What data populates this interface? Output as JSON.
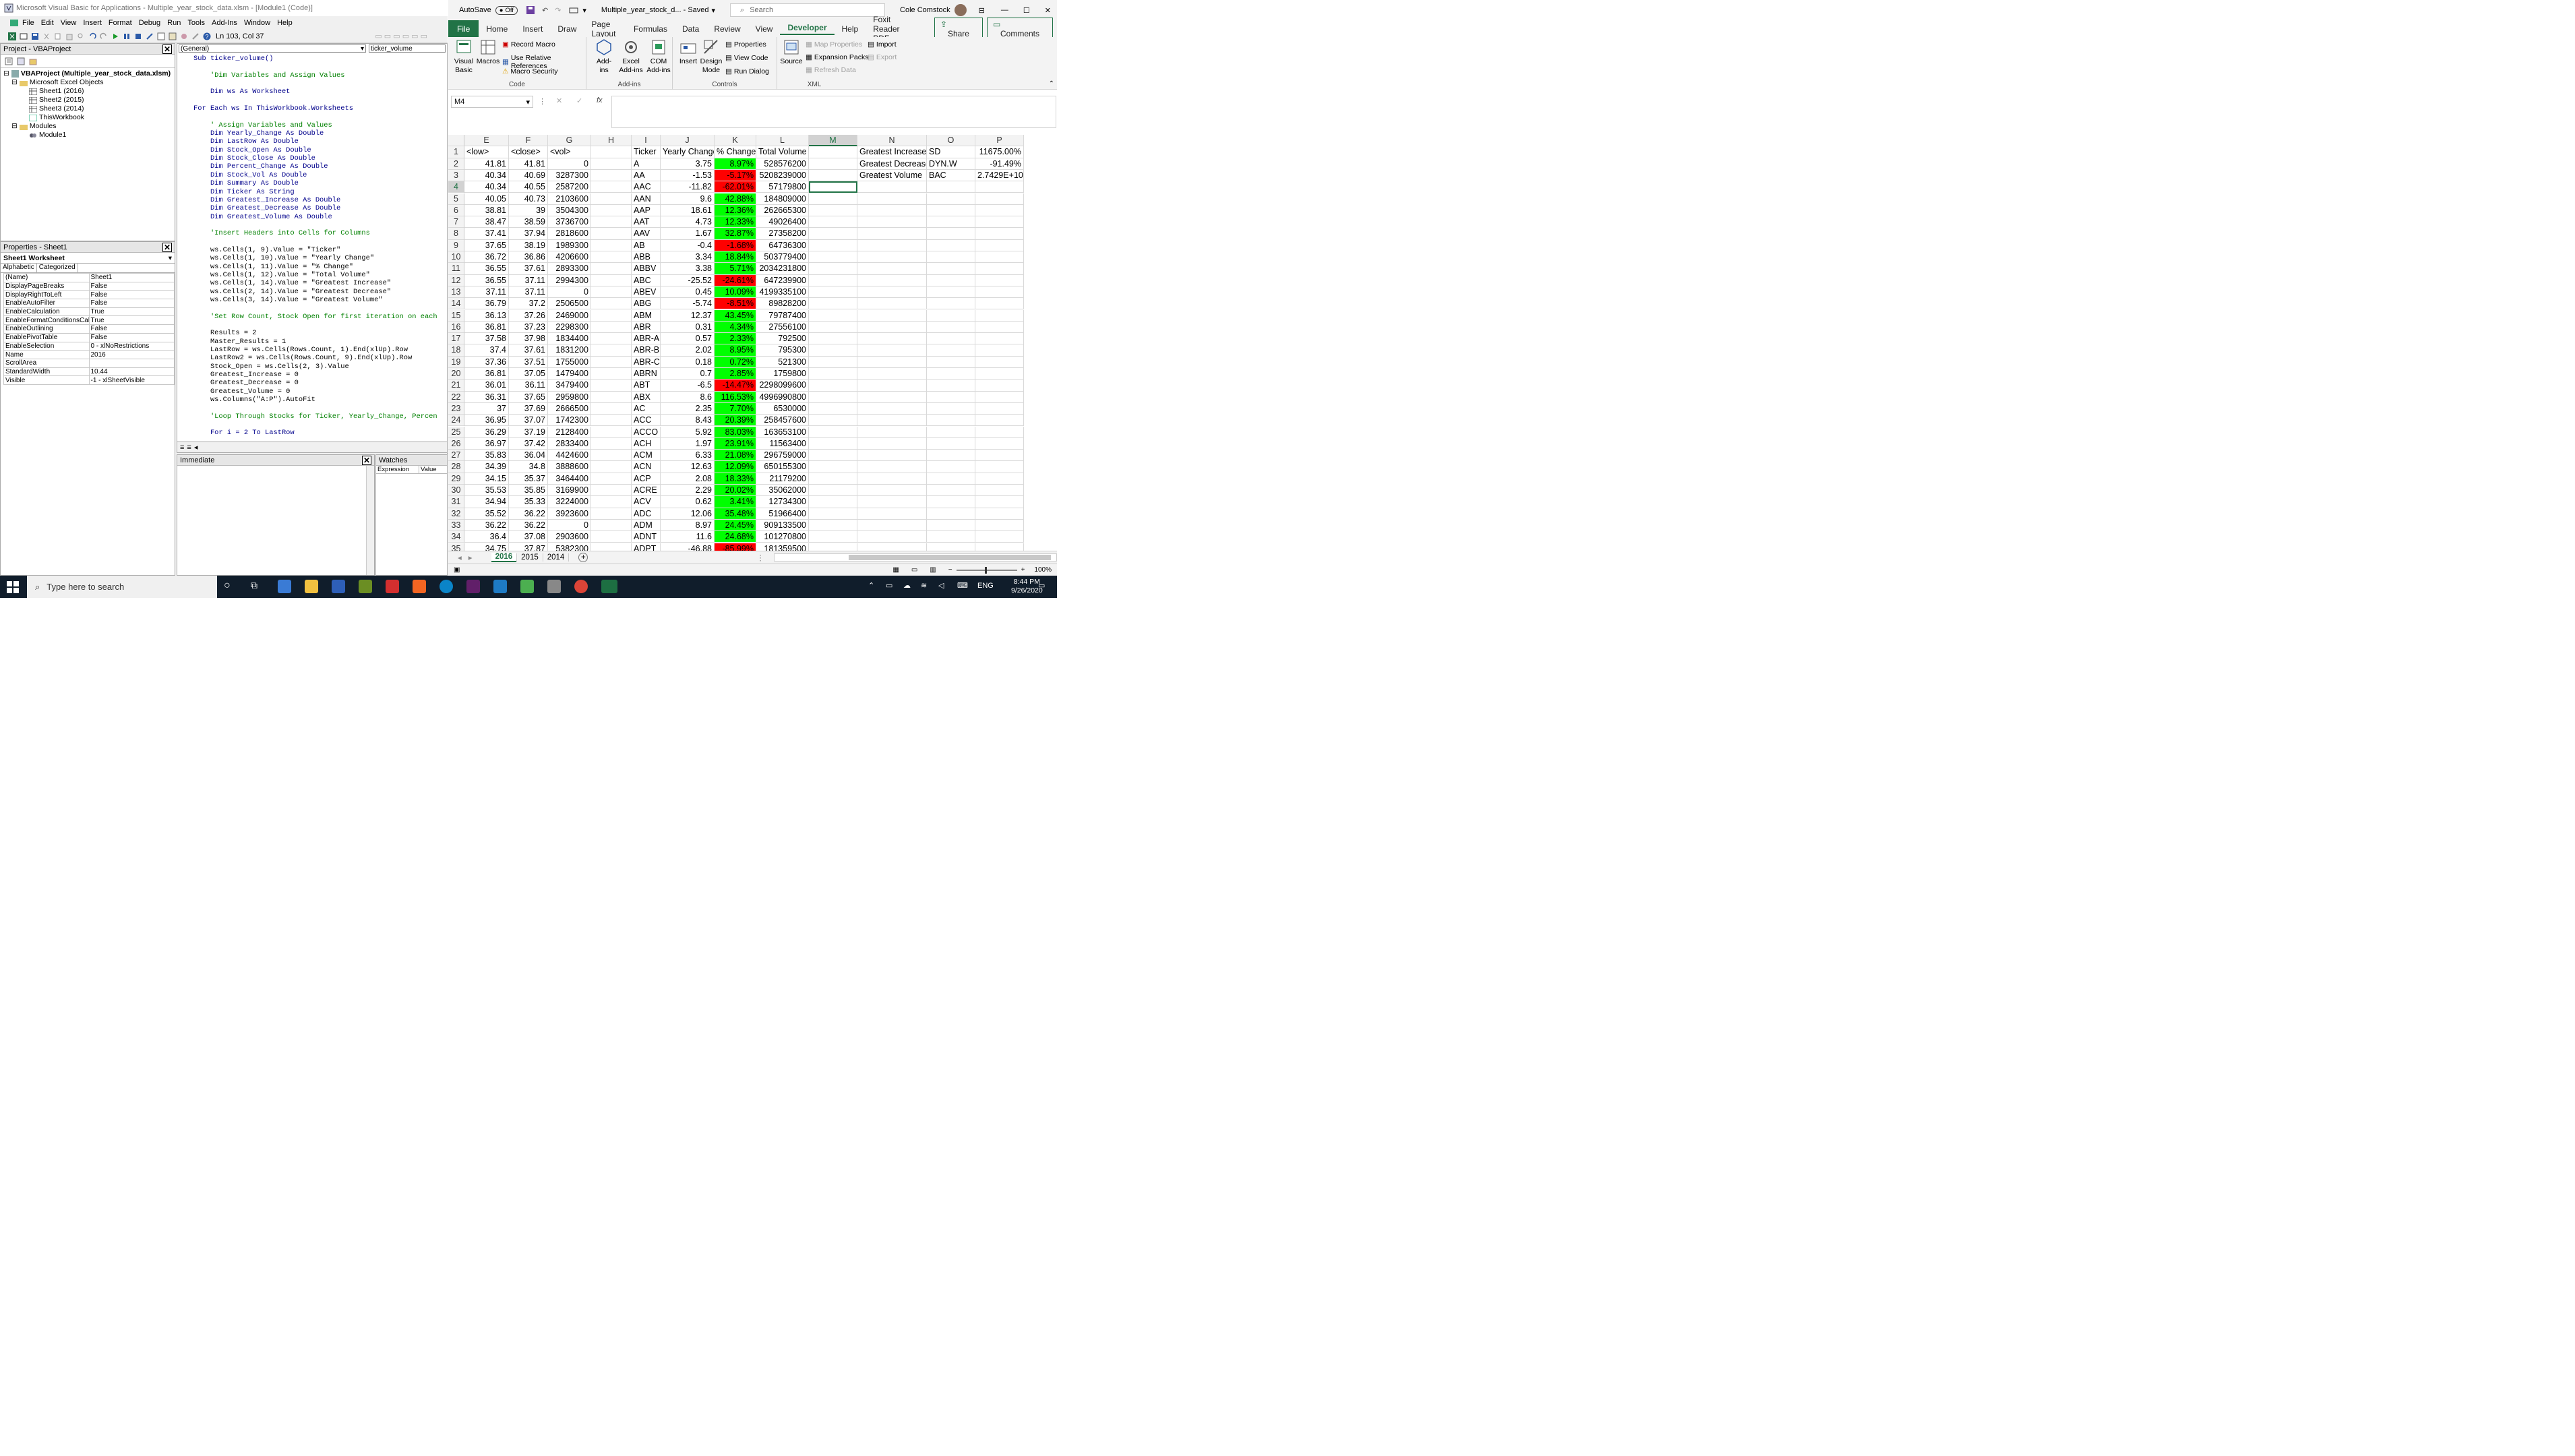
{
  "vbe": {
    "title": "Microsoft Visual Basic for Applications - Multiple_year_stock_data.xlsm - [Module1 (Code)]",
    "menu": [
      "File",
      "Edit",
      "View",
      "Insert",
      "Format",
      "Debug",
      "Run",
      "Tools",
      "Add-Ins",
      "Window",
      "Help"
    ],
    "position": "Ln 103, Col 37",
    "project": {
      "header": "Project - VBAProject",
      "root": "VBAProject (Multiple_year_stock_data.xlsm)",
      "folder_objects": "Microsoft Excel Objects",
      "sheets": [
        "Sheet1 (2016)",
        "Sheet2 (2015)",
        "Sheet3 (2014)",
        "ThisWorkbook"
      ],
      "folder_modules": "Modules",
      "module": "Module1"
    },
    "properties": {
      "header": "Properties - Sheet1",
      "selector": "Sheet1 Worksheet",
      "tabs": [
        "Alphabetic",
        "Categorized"
      ],
      "rows": [
        [
          "(Name)",
          "Sheet1"
        ],
        [
          "DisplayPageBreaks",
          "False"
        ],
        [
          "DisplayRightToLeft",
          "False"
        ],
        [
          "EnableAutoFilter",
          "False"
        ],
        [
          "EnableCalculation",
          "True"
        ],
        [
          "EnableFormatConditionsCalcul",
          "True"
        ],
        [
          "EnableOutlining",
          "False"
        ],
        [
          "EnablePivotTable",
          "False"
        ],
        [
          "EnableSelection",
          "0 - xlNoRestrictions"
        ],
        [
          "Name",
          "2016"
        ],
        [
          "ScrollArea",
          ""
        ],
        [
          "StandardWidth",
          "10.44"
        ],
        [
          "Visible",
          "-1 - xlSheetVisible"
        ]
      ]
    },
    "code": {
      "combo_left": "(General)",
      "combo_right": "ticker_volume",
      "lines": [
        {
          "t": "Sub ticker_volume()",
          "c": "kw"
        },
        {
          "t": "",
          "c": ""
        },
        {
          "t": "    'Dim Variables and Assign Values",
          "c": "cm"
        },
        {
          "t": "",
          "c": ""
        },
        {
          "t": "    Dim ws As Worksheet",
          "c": "kw"
        },
        {
          "t": "",
          "c": ""
        },
        {
          "t": "For Each ws In ThisWorkbook.Worksheets",
          "c": "kw"
        },
        {
          "t": "",
          "c": ""
        },
        {
          "t": "    ' Assign Variables and Values",
          "c": "cm"
        },
        {
          "t": "    Dim Yearly_Change As Double",
          "c": "kw"
        },
        {
          "t": "    Dim LastRow As Double",
          "c": "kw"
        },
        {
          "t": "    Dim Stock_Open As Double",
          "c": "kw"
        },
        {
          "t": "    Dim Stock_Close As Double",
          "c": "kw"
        },
        {
          "t": "    Dim Percent_Change As Double",
          "c": "kw"
        },
        {
          "t": "    Dim Stock_Vol As Double",
          "c": "kw"
        },
        {
          "t": "    Dim Summary As Double",
          "c": "kw"
        },
        {
          "t": "    Dim Ticker As String",
          "c": "kw"
        },
        {
          "t": "    Dim Greatest_Increase As Double",
          "c": "kw"
        },
        {
          "t": "    Dim Greatest_Decrease As Double",
          "c": "kw"
        },
        {
          "t": "    Dim Greatest_Volume As Double",
          "c": "kw"
        },
        {
          "t": "",
          "c": ""
        },
        {
          "t": "    'Insert Headers into Cells for Columns",
          "c": "cm"
        },
        {
          "t": "",
          "c": ""
        },
        {
          "t": "    ws.Cells(1, 9).Value = \"Ticker\"",
          "c": ""
        },
        {
          "t": "    ws.Cells(1, 10).Value = \"Yearly Change\"",
          "c": ""
        },
        {
          "t": "    ws.Cells(1, 11).Value = \"% Change\"",
          "c": ""
        },
        {
          "t": "    ws.Cells(1, 12).Value = \"Total Volume\"",
          "c": ""
        },
        {
          "t": "    ws.Cells(1, 14).Value = \"Greatest Increase\"",
          "c": ""
        },
        {
          "t": "    ws.Cells(2, 14).Value = \"Greatest Decrease\"",
          "c": ""
        },
        {
          "t": "    ws.Cells(3, 14).Value = \"Greatest Volume\"",
          "c": ""
        },
        {
          "t": "",
          "c": ""
        },
        {
          "t": "    'Set Row Count, Stock Open for first iteration on each",
          "c": "cm"
        },
        {
          "t": "",
          "c": ""
        },
        {
          "t": "    Results = 2",
          "c": ""
        },
        {
          "t": "    Master_Results = 1",
          "c": ""
        },
        {
          "t": "    LastRow = ws.Cells(Rows.Count, 1).End(xlUp).Row",
          "c": ""
        },
        {
          "t": "    LastRow2 = ws.Cells(Rows.Count, 9).End(xlUp).Row",
          "c": ""
        },
        {
          "t": "    Stock_Open = ws.Cells(2, 3).Value",
          "c": ""
        },
        {
          "t": "    Greatest_Increase = 0",
          "c": ""
        },
        {
          "t": "    Greatest_Decrease = 0",
          "c": ""
        },
        {
          "t": "    Greatest_Volume = 0",
          "c": ""
        },
        {
          "t": "    ws.Columns(\"A:P\").AutoFit",
          "c": ""
        },
        {
          "t": "",
          "c": ""
        },
        {
          "t": "    'Loop Through Stocks for Ticker, Yearly_Change, Percen",
          "c": "cm"
        },
        {
          "t": "",
          "c": ""
        },
        {
          "t": "    For i = 2 To LastRow",
          "c": "kw"
        }
      ]
    },
    "immediate": "Immediate",
    "watches": {
      "header": "Watches",
      "cols": [
        "Expression",
        "Value"
      ]
    }
  },
  "excel": {
    "autosave": "AutoSave",
    "autosave_state": "Off",
    "filename": "Multiple_year_stock_d...  -  Saved",
    "search_placeholder": "Search",
    "user": "Cole Comstock",
    "tabs": [
      "File",
      "Home",
      "Insert",
      "Draw",
      "Page Layout",
      "Formulas",
      "Data",
      "Review",
      "View",
      "Developer",
      "Help",
      "Foxit Reader PDF"
    ],
    "share": "Share",
    "comments": "Comments",
    "ribbon": {
      "visual_basic": "Visual Basic",
      "macros": "Macros",
      "record_macro": "Record Macro",
      "relative_refs": "Use Relative References",
      "macro_security": "Macro Security",
      "code_label": "Code",
      "addins": "Add-ins",
      "excel_addins": "Excel Add-ins",
      "com_addins": "COM Add-ins",
      "addins_label": "Add-ins",
      "insert": "Insert",
      "design_mode": "Design Mode",
      "properties": "Properties",
      "view_code": "View Code",
      "run_dialog": "Run Dialog",
      "controls_label": "Controls",
      "source": "Source",
      "map_properties": "Map Properties",
      "expansion_packs": "Expansion Packs",
      "refresh_data": "Refresh Data",
      "import": "Import",
      "export": "Export",
      "xml_label": "XML"
    },
    "namebox": "M4",
    "fx": "fx",
    "columns": [
      "E",
      "F",
      "G",
      "H",
      "I",
      "J",
      "K",
      "L",
      "M",
      "N",
      "O",
      "P"
    ],
    "header_row": [
      "<low>",
      "<close>",
      "<vol>",
      "",
      "Ticker",
      "Yearly Change",
      "% Change",
      "Total Volume",
      "",
      "Greatest Increase",
      "SD",
      "11675.00%"
    ],
    "summary": [
      [
        "Greatest Decrease",
        "DYN.W",
        "-91.49%"
      ],
      [
        "Greatest Volume",
        "BAC",
        "2.7429E+10"
      ]
    ],
    "rows": [
      [
        "41.81",
        "41.81",
        "0",
        "A",
        "3.75",
        "8.97%",
        "528576200"
      ],
      [
        "40.34",
        "40.69",
        "3287300",
        "AA",
        "-1.53",
        "-5.17%",
        "5208239000"
      ],
      [
        "40.34",
        "40.55",
        "2587200",
        "AAC",
        "-11.82",
        "-62.01%",
        "57179800"
      ],
      [
        "40.05",
        "40.73",
        "2103600",
        "AAN",
        "9.6",
        "42.88%",
        "184809000"
      ],
      [
        "38.81",
        "39",
        "3504300",
        "AAP",
        "18.61",
        "12.36%",
        "262665300"
      ],
      [
        "38.47",
        "38.59",
        "3736700",
        "AAT",
        "4.73",
        "12.33%",
        "49026400"
      ],
      [
        "37.41",
        "37.94",
        "2818600",
        "AAV",
        "1.67",
        "32.87%",
        "27358200"
      ],
      [
        "37.65",
        "38.19",
        "1989300",
        "AB",
        "-0.4",
        "-1.68%",
        "64736300"
      ],
      [
        "36.72",
        "36.86",
        "4206600",
        "ABB",
        "3.34",
        "18.84%",
        "503779400"
      ],
      [
        "36.55",
        "37.61",
        "2893300",
        "ABBV",
        "3.38",
        "5.71%",
        "2034231800"
      ],
      [
        "36.55",
        "37.11",
        "2994300",
        "ABC",
        "-25.52",
        "-24.61%",
        "647239900"
      ],
      [
        "37.11",
        "37.11",
        "0",
        "ABEV",
        "0.45",
        "10.09%",
        "4199335100"
      ],
      [
        "36.79",
        "37.2",
        "2506500",
        "ABG",
        "-5.74",
        "-8.51%",
        "89828200"
      ],
      [
        "36.13",
        "37.26",
        "2469000",
        "ABM",
        "12.37",
        "43.45%",
        "79787400"
      ],
      [
        "36.81",
        "37.23",
        "2298300",
        "ABR",
        "0.31",
        "4.34%",
        "27556100"
      ],
      [
        "37.58",
        "37.98",
        "1834400",
        "ABR-A",
        "0.57",
        "2.33%",
        "792500"
      ],
      [
        "37.4",
        "37.61",
        "1831200",
        "ABR-B",
        "2.02",
        "8.95%",
        "795300"
      ],
      [
        "37.36",
        "37.51",
        "1755000",
        "ABR-C",
        "0.18",
        "0.72%",
        "521300"
      ],
      [
        "36.81",
        "37.05",
        "1479400",
        "ABRN",
        "0.7",
        "2.85%",
        "1759800"
      ],
      [
        "36.01",
        "36.11",
        "3479400",
        "ABT",
        "-6.5",
        "-14.47%",
        "2298099600"
      ],
      [
        "36.31",
        "37.65",
        "2959800",
        "ABX",
        "8.6",
        "116.53%",
        "4996990800"
      ],
      [
        "37",
        "37.69",
        "2666500",
        "AC",
        "2.35",
        "7.70%",
        "6530000"
      ],
      [
        "36.95",
        "37.07",
        "1742300",
        "ACC",
        "8.43",
        "20.39%",
        "258457600"
      ],
      [
        "36.29",
        "37.19",
        "2128400",
        "ACCO",
        "5.92",
        "83.03%",
        "163653100"
      ],
      [
        "36.97",
        "37.42",
        "2833400",
        "ACH",
        "1.97",
        "23.91%",
        "11563400"
      ],
      [
        "35.83",
        "36.04",
        "4424600",
        "ACM",
        "6.33",
        "21.08%",
        "296759000"
      ],
      [
        "34.39",
        "34.8",
        "3888600",
        "ACN",
        "12.63",
        "12.09%",
        "650155300"
      ],
      [
        "34.15",
        "35.37",
        "3464400",
        "ACP",
        "2.08",
        "18.33%",
        "21179200"
      ],
      [
        "35.53",
        "35.85",
        "3169900",
        "ACRE",
        "2.29",
        "20.02%",
        "35062000"
      ],
      [
        "34.94",
        "35.33",
        "3224000",
        "ACV",
        "0.62",
        "3.41%",
        "12734300"
      ],
      [
        "35.52",
        "36.22",
        "3923600",
        "ADC",
        "12.06",
        "35.48%",
        "51966400"
      ],
      [
        "36.22",
        "36.22",
        "0",
        "ADM",
        "8.97",
        "24.45%",
        "909133500"
      ],
      [
        "36.4",
        "37.08",
        "2903600",
        "ADNT",
        "11.6",
        "24.68%",
        "101270800"
      ],
      [
        "34.75",
        "37.87",
        "5382300",
        "ADPT",
        "-46.88",
        "-85.99%",
        "181359500"
      ]
    ],
    "sheets": [
      "2016",
      "2015",
      "2014"
    ],
    "zoom": "100%"
  },
  "taskbar": {
    "search_placeholder": "Type here to search",
    "lang": "ENG",
    "time": "8:44 PM",
    "date": "9/26/2020"
  },
  "colors": {
    "excel_green": "#217346",
    "positive": "#00ff00",
    "negative": "#ff0000"
  }
}
